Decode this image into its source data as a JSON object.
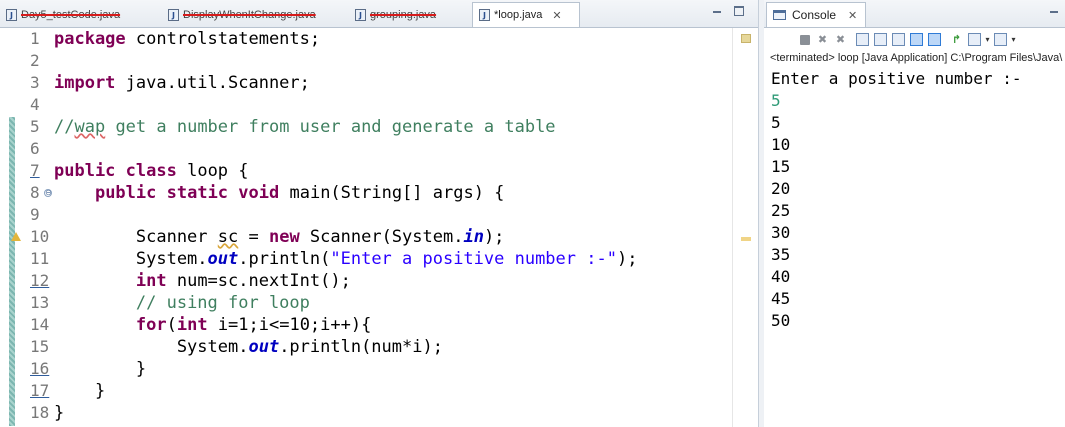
{
  "editor": {
    "tabs": [
      {
        "label": "Day5_testCode.java",
        "state": "error"
      },
      {
        "label": "DisplayWhenItChange.java",
        "state": "error"
      },
      {
        "label": "grouping.java",
        "state": "error"
      },
      {
        "label": "*loop.java",
        "state": "active"
      }
    ],
    "close_glyph": "✕",
    "line_numbers": [
      "1",
      "2",
      "3",
      "4",
      "5",
      "6",
      "7",
      "8",
      "9",
      "10",
      "11",
      "12",
      "13",
      "14",
      "15",
      "16",
      "17",
      "18"
    ],
    "fold_glyph": "⊖",
    "code": {
      "l1_kw": "package",
      "l1_rest": " controlstatements;",
      "l3_kw": "import",
      "l3_rest": " java.util.Scanner;",
      "l5_a": "//",
      "l5_wap": "wap",
      "l5_b": " get a number from user and generate a table",
      "l7_kw1": "public",
      "l7_kw2": "class",
      "l7_rest": " loop {",
      "l8_indent": "    ",
      "l8_kw1": "public",
      "l8_kw2": "static",
      "l8_kw3": "void",
      "l8_rest": " main(String[] args) {",
      "l10_a": "        Scanner ",
      "l10_sc": "sc",
      "l10_b": " = ",
      "l10_kw": "new",
      "l10_c": " Scanner(System.",
      "l10_in": "in",
      "l10_d": ");",
      "l11_a": "        System.",
      "l11_out": "out",
      "l11_b": ".println(",
      "l11_str": "\"Enter a positive number :-\"",
      "l11_c": ");",
      "l12_indent": "        ",
      "l12_kw": "int",
      "l12_rest": " num=sc.nextInt();",
      "l13_indent": "        ",
      "l13_cm": "// using for loop",
      "l14_indent": "        ",
      "l14_kw1": "for",
      "l14_a": "(",
      "l14_kw2": "int",
      "l14_b": " i=1;i<=10;i++){",
      "l15_a": "            System.",
      "l15_out": "out",
      "l15_b": ".println(num*i);",
      "l16": "        }",
      "l17": "    }",
      "l18": "}"
    }
  },
  "console": {
    "tab_label": "Console",
    "close_glyph": "✕",
    "status": "<terminated> loop [Java Application] C:\\Program Files\\Java\\",
    "output": {
      "prompt": "Enter a positive number :-",
      "user_input": "5",
      "results": [
        "5",
        "10",
        "15",
        "20",
        "25",
        "30",
        "35",
        "40",
        "45",
        "50"
      ]
    },
    "toolbar_icons": [
      "terminate-icon",
      "remove-launch-icon",
      "remove-all-terminated-icon",
      "clear-console-icon",
      "scroll-lock-icon",
      "word-wrap-icon",
      "show-on-stdout-icon",
      "show-on-stderr-icon",
      "pin-console-icon",
      "display-console-icon",
      "display-console-dropdown-icon",
      "open-console-icon",
      "open-console-dropdown-icon"
    ]
  },
  "colors": {
    "keyword": "#7f0055",
    "comment": "#3f7f5f",
    "string": "#2a00ff",
    "static_field": "#0000c0",
    "console_input": "#2e9a76",
    "error_strike": "#d61b1b"
  }
}
